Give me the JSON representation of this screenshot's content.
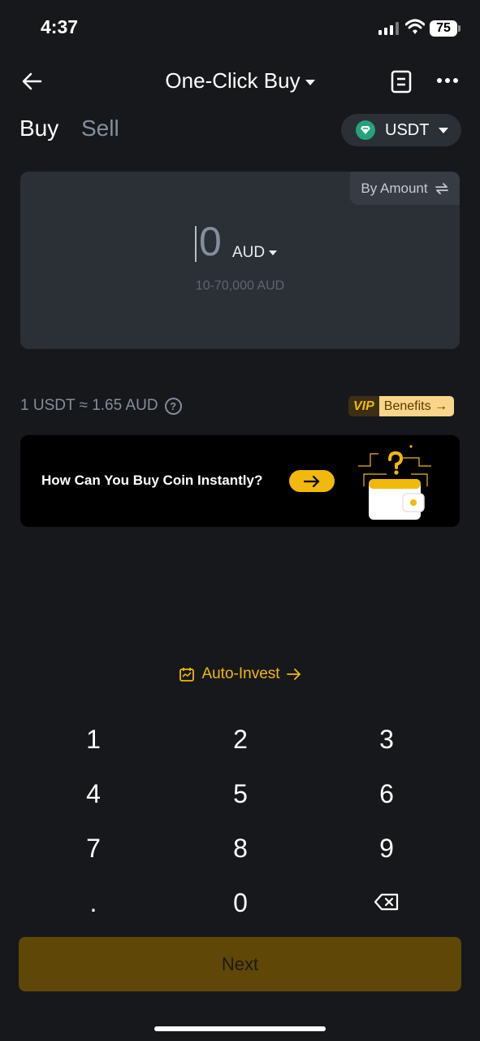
{
  "status_bar": {
    "time": "4:37",
    "battery": "75"
  },
  "header": {
    "title": "One-Click Buy"
  },
  "tabs": {
    "buy": "Buy",
    "sell": "Sell"
  },
  "coin_selector": {
    "label": "USDT"
  },
  "amount_card": {
    "mode_label": "By Amount",
    "amount": "0",
    "currency": "AUD",
    "range": "10-70,000 AUD"
  },
  "rate": {
    "text": "1 USDT ≈ 1.65 AUD"
  },
  "vip": {
    "tag": "VIP",
    "label": "Benefits →"
  },
  "banner": {
    "text": "How Can You Buy Coin Instantly?"
  },
  "auto_invest": {
    "label": "Auto-Invest"
  },
  "keypad": {
    "k1": "1",
    "k2": "2",
    "k3": "3",
    "k4": "4",
    "k5": "5",
    "k6": "6",
    "k7": "7",
    "k8": "8",
    "k9": "9",
    "kdot": ".",
    "k0": "0"
  },
  "next_button": {
    "label": "Next"
  },
  "colors": {
    "accent": "#f0b90b",
    "background": "#17181b",
    "card": "#2b2f36",
    "next_disabled": "#5f4708"
  }
}
